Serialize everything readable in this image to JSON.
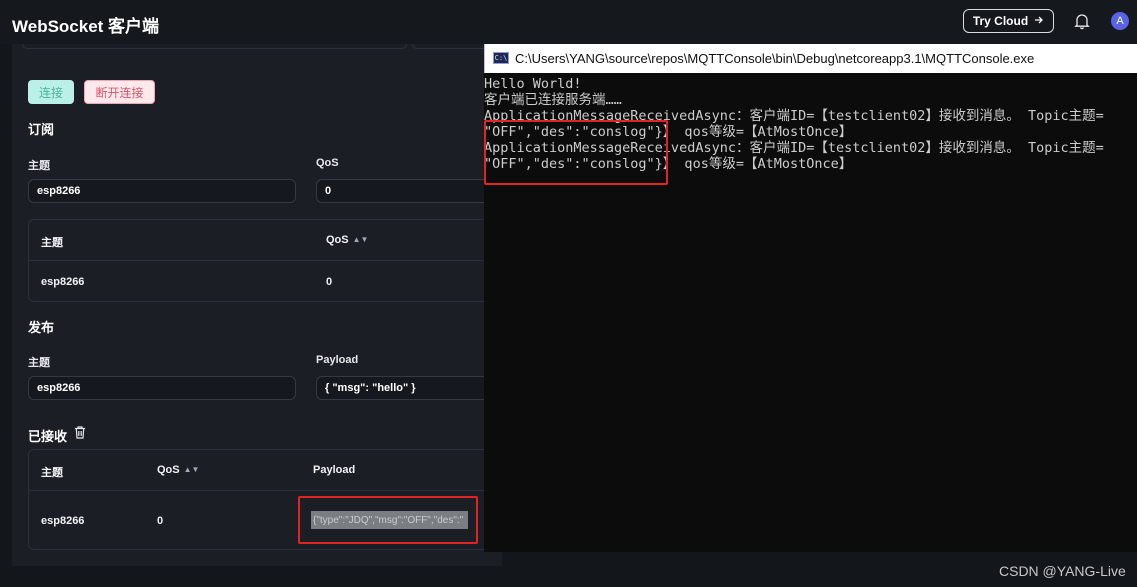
{
  "header": {
    "title": "WebSocket 客户端",
    "try_cloud_label": "Try Cloud",
    "avatar_initial": "A"
  },
  "connection": {
    "connect_label": "连接",
    "disconnect_label": "断开连接"
  },
  "subscribe": {
    "section_title": "订阅",
    "topic_label": "主题",
    "topic_value": "esp8266",
    "qos_label": "QoS",
    "qos_value": "0",
    "table": {
      "headers": [
        "主题",
        "QoS"
      ],
      "rows": [
        {
          "topic": "esp8266",
          "qos": "0"
        }
      ]
    }
  },
  "publish": {
    "section_title": "发布",
    "topic_label": "主题",
    "topic_value": "esp8266",
    "payload_label": "Payload",
    "payload_value": "{ \"msg\": \"hello\" }"
  },
  "received": {
    "section_title": "已接收",
    "table": {
      "headers": [
        "主题",
        "QoS",
        "Payload"
      ],
      "rows": [
        {
          "topic": "esp8266",
          "qos": "0",
          "payload": "{\"type\":\"JDQ\",\"msg\":\"OFF\",\"des\":\""
        }
      ]
    }
  },
  "console": {
    "window_title": "C:\\Users\\YANG\\source\\repos\\MQTTConsole\\bin\\Debug\\netcoreapp3.1\\MQTTConsole.exe",
    "lines": [
      "Hello World!",
      "客户端已连接服务端……",
      "ApplicationMessageReceivedAsync：客户端ID=【testclient02】接收到消息。 Topic主题=",
      "\"OFF\",\"des\":\"conslog\"}】 qos等级=【AtMostOnce】",
      "ApplicationMessageReceivedAsync：客户端ID=【testclient02】接收到消息。 Topic主题=",
      "\"OFF\",\"des\":\"conslog\"}】 qos等级=【AtMostOnce】"
    ]
  },
  "watermark": "CSDN @YANG-Live",
  "colors": {
    "highlight_box": "#e02420",
    "connect_bg": "#baf0e7",
    "disconnect_text": "#e0526a",
    "avatar": "#5a63e6"
  },
  "icons": {
    "bell": "bell-icon",
    "trash": "trash-icon",
    "arrow": "arrow-right-icon",
    "console": "console-app-icon"
  }
}
